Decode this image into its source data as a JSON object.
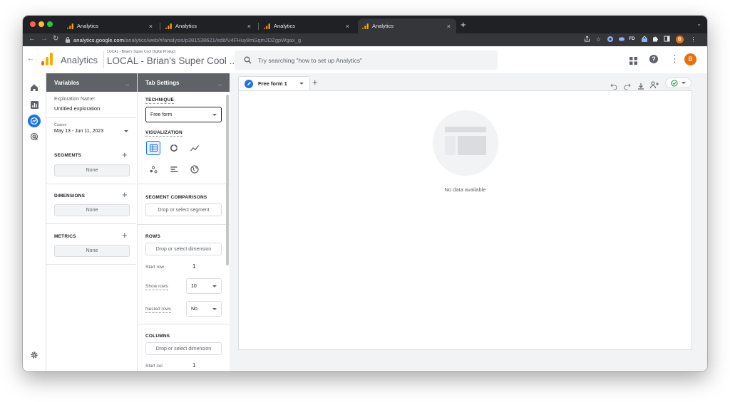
{
  "browser": {
    "tabs": [
      {
        "title": "Analytics"
      },
      {
        "title": "Analytics"
      },
      {
        "title": "Analytics"
      },
      {
        "title": "Analytics"
      }
    ],
    "new_tab": "+",
    "close_glyph": "×",
    "url_host": "analytics.google.com",
    "url_path": "/analytics/web/#/analysis/p381538621/edit/V4FHuy8mSqmJDZgpWgax_g",
    "profile_initial": "B",
    "ext_fd": "FD"
  },
  "header": {
    "product": "Analytics",
    "account_path": "LOCAL - Brian's Super Cool Digital Product",
    "property": "LOCAL - Brian's Super Cool ...",
    "search_placeholder": "Try searching \"how to set up Analytics\"",
    "avatar_initial": "B"
  },
  "variables": {
    "title": "Variables",
    "minimize": "_",
    "exploration_label": "Exploration Name:",
    "exploration_name": "Untitled exploration",
    "date_tag": "Custom",
    "date_range": "May 13 - Jun 11, 2023",
    "segments": {
      "label": "SEGMENTS",
      "empty": "None"
    },
    "dimensions": {
      "label": "DIMENSIONS",
      "empty": "None"
    },
    "metrics": {
      "label": "METRICS",
      "empty": "None"
    }
  },
  "tab_settings": {
    "title": "Tab Settings",
    "minimize": "_",
    "technique_label": "TECHNIQUE",
    "technique_value": "Free form",
    "visualization_label": "VISUALIZATION",
    "segment_comparisons_label": "SEGMENT COMPARISONS",
    "segment_drop": "Drop or select segment",
    "rows_label": "ROWS",
    "rows_drop": "Drop or select dimension",
    "start_row_label": "Start row",
    "start_row_value": "1",
    "show_rows_label": "Show rows",
    "show_rows_value": "10",
    "nested_rows_label": "Nested rows",
    "nested_rows_value": "No",
    "columns_label": "COLUMNS",
    "columns_drop": "Drop or select dimension",
    "start_column_label": "Start col",
    "start_column_value": "1"
  },
  "canvas": {
    "tab_label": "Free form 1",
    "add_tab": "+",
    "empty_message": "No data available"
  },
  "colors": {
    "ga_orange": "#F9AB00",
    "ga_dark_orange": "#E37400",
    "accent_blue": "#1a73e8",
    "success_green": "#1e8e3e",
    "avatar_orange": "#e8710a"
  }
}
